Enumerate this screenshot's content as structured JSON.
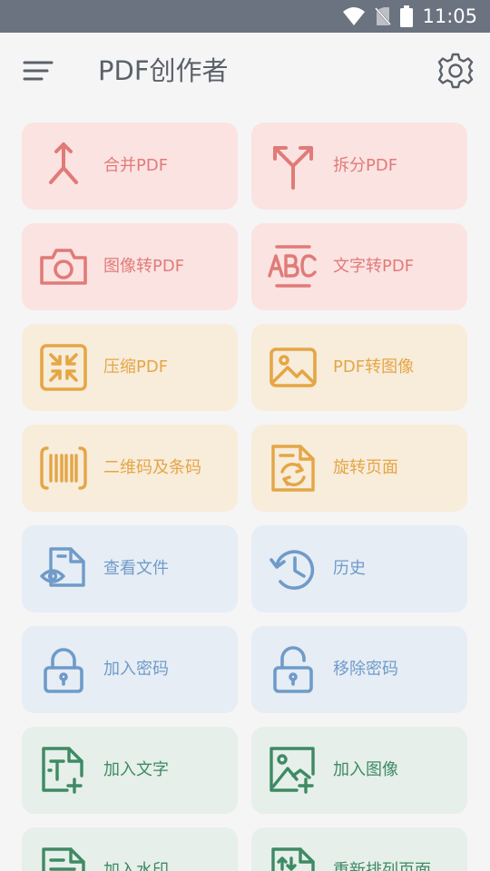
{
  "status_bar": {
    "time": "11:05"
  },
  "app": {
    "title": "PDF创作者"
  },
  "colors": {
    "red": "#e07b78",
    "yellow": "#e4a646",
    "blue": "#6f9bc9",
    "green": "#3e8a64"
  },
  "tools": [
    {
      "label": "合并PDF",
      "icon": "merge-icon"
    },
    {
      "label": "拆分PDF",
      "icon": "split-icon"
    },
    {
      "label": "图像转PDF",
      "icon": "camera-icon"
    },
    {
      "label": "文字转PDF",
      "icon": "abc-text-icon"
    },
    {
      "label": "压缩PDF",
      "icon": "compress-icon"
    },
    {
      "label": "PDF转图像",
      "icon": "image-icon"
    },
    {
      "label": "二维码及条码",
      "icon": "barcode-icon"
    },
    {
      "label": "旋转页面",
      "icon": "rotate-page-icon"
    },
    {
      "label": "查看文件",
      "icon": "view-file-icon"
    },
    {
      "label": "历史",
      "icon": "history-icon"
    },
    {
      "label": "加入密码",
      "icon": "lock-icon"
    },
    {
      "label": "移除密码",
      "icon": "unlock-icon"
    },
    {
      "label": "加入文字",
      "icon": "add-text-icon"
    },
    {
      "label": "加入图像",
      "icon": "add-image-icon"
    },
    {
      "label": "加入水印",
      "icon": "watermark-icon"
    },
    {
      "label": "重新排列页面",
      "icon": "reorder-pages-icon"
    }
  ]
}
